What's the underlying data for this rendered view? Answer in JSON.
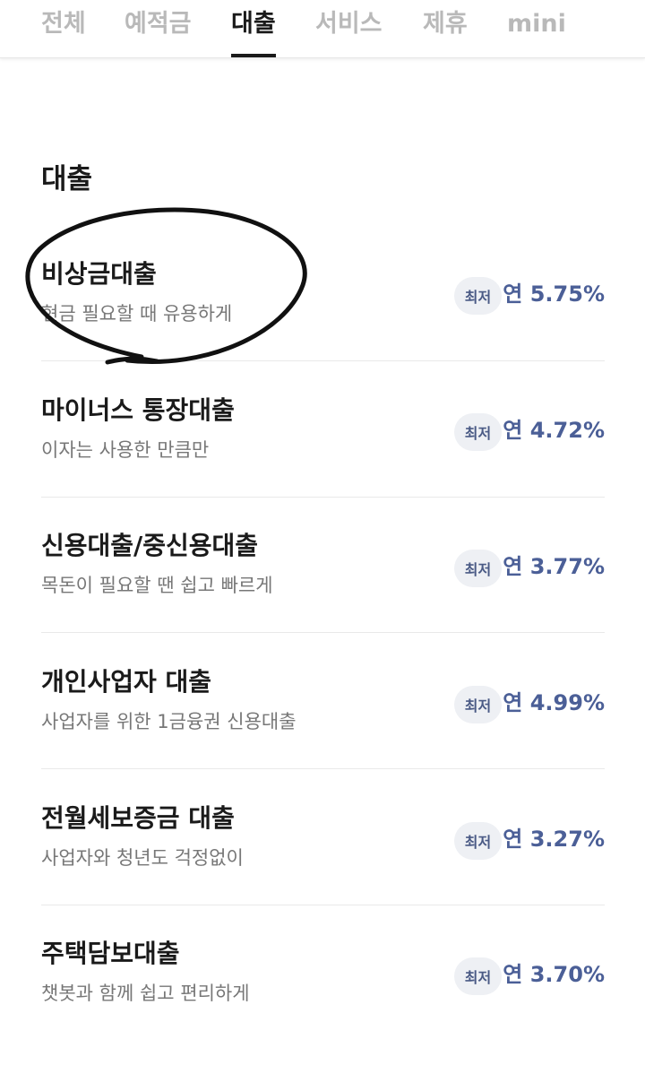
{
  "tabs": [
    {
      "label": "전체",
      "active": false
    },
    {
      "label": "예적금",
      "active": false
    },
    {
      "label": "대출",
      "active": true
    },
    {
      "label": "서비스",
      "active": false
    },
    {
      "label": "제휴",
      "active": false
    },
    {
      "label": "mini",
      "active": false
    }
  ],
  "section": {
    "title": "대출"
  },
  "loans": [
    {
      "title": "비상금대출",
      "subtitle": "현금 필요할 때 유용하게",
      "badge": "최저",
      "rate": "연 5.75%"
    },
    {
      "title": "마이너스 통장대출",
      "subtitle": "이자는 사용한 만큼만",
      "badge": "최저",
      "rate": "연 4.72%"
    },
    {
      "title": "신용대출/중신용대출",
      "subtitle": "목돈이 필요할 땐 쉽고 빠르게",
      "badge": "최저",
      "rate": "연 3.77%"
    },
    {
      "title": "개인사업자 대출",
      "subtitle": "사업자를 위한 1금융권 신용대출",
      "badge": "최저",
      "rate": "연 4.99%"
    },
    {
      "title": "전월세보증금 대출",
      "subtitle": "사업자와 청년도 걱정없이",
      "badge": "최저",
      "rate": "연 3.27%"
    },
    {
      "title": "주택담보대출",
      "subtitle": "챗봇과 함께 쉽고 편리하게",
      "badge": "최저",
      "rate": "연 3.70%"
    }
  ],
  "colors": {
    "accent_text": "#4b5f97",
    "badge_bg": "#eef0f4",
    "inactive_tab": "#b9b9b9"
  }
}
